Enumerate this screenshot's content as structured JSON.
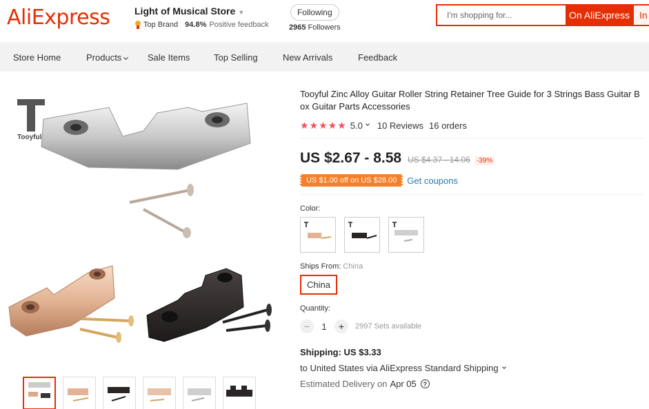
{
  "header": {
    "logo": "AliExpress",
    "store_name": "Light of Musical Store",
    "badge": "Top Brand",
    "positive_rate": "94.8%",
    "positive_label": "Positive feedback",
    "follow_label": "Following",
    "followers_count": "2965",
    "followers_label": "Followers",
    "search_placeholder": "I'm shopping for...",
    "search_button": "On AliExpress",
    "search_in": "In"
  },
  "nav": {
    "items": [
      "Store Home",
      "Products",
      "Sale Items",
      "Top Selling",
      "New Arrivals",
      "Feedback"
    ]
  },
  "gallery": {
    "brand": "Tooyful",
    "thumbnail_count": 6,
    "selected_index": 0
  },
  "product": {
    "title": "Tooyful Zinc Alloy Guitar Roller String Retainer Tree Guide for 3 Strings Bass Guitar Box Guitar Parts Accessories",
    "stars": "★★★★★",
    "rating": "5.0",
    "reviews": "10 Reviews",
    "orders": "16 orders",
    "price": "US $2.67 - 8.58",
    "original_price": "US $4.37 - 14.06",
    "discount": "-39%",
    "coupon": "US $1.00 off on US $28.00",
    "get_coupons": "Get coupons",
    "color_label": "Color:",
    "colors": [
      "gold",
      "black",
      "silver"
    ],
    "ships_from_label": "Ships From:",
    "ships_from_value": "China",
    "ships_option": "China",
    "quantity_label": "Quantity:",
    "quantity": "1",
    "available": "2997 Sets available",
    "shipping_title": "Shipping: US $3.33",
    "shipping_line": "to United States via AliExpress Standard Shipping",
    "estimated_label": "Estimated Delivery on",
    "estimated_date": "Apr 05"
  },
  "colors": {
    "brand": "#e62e04",
    "star": "#f44c5b",
    "coupon": "#f5802a",
    "link": "#2a7ab5"
  }
}
